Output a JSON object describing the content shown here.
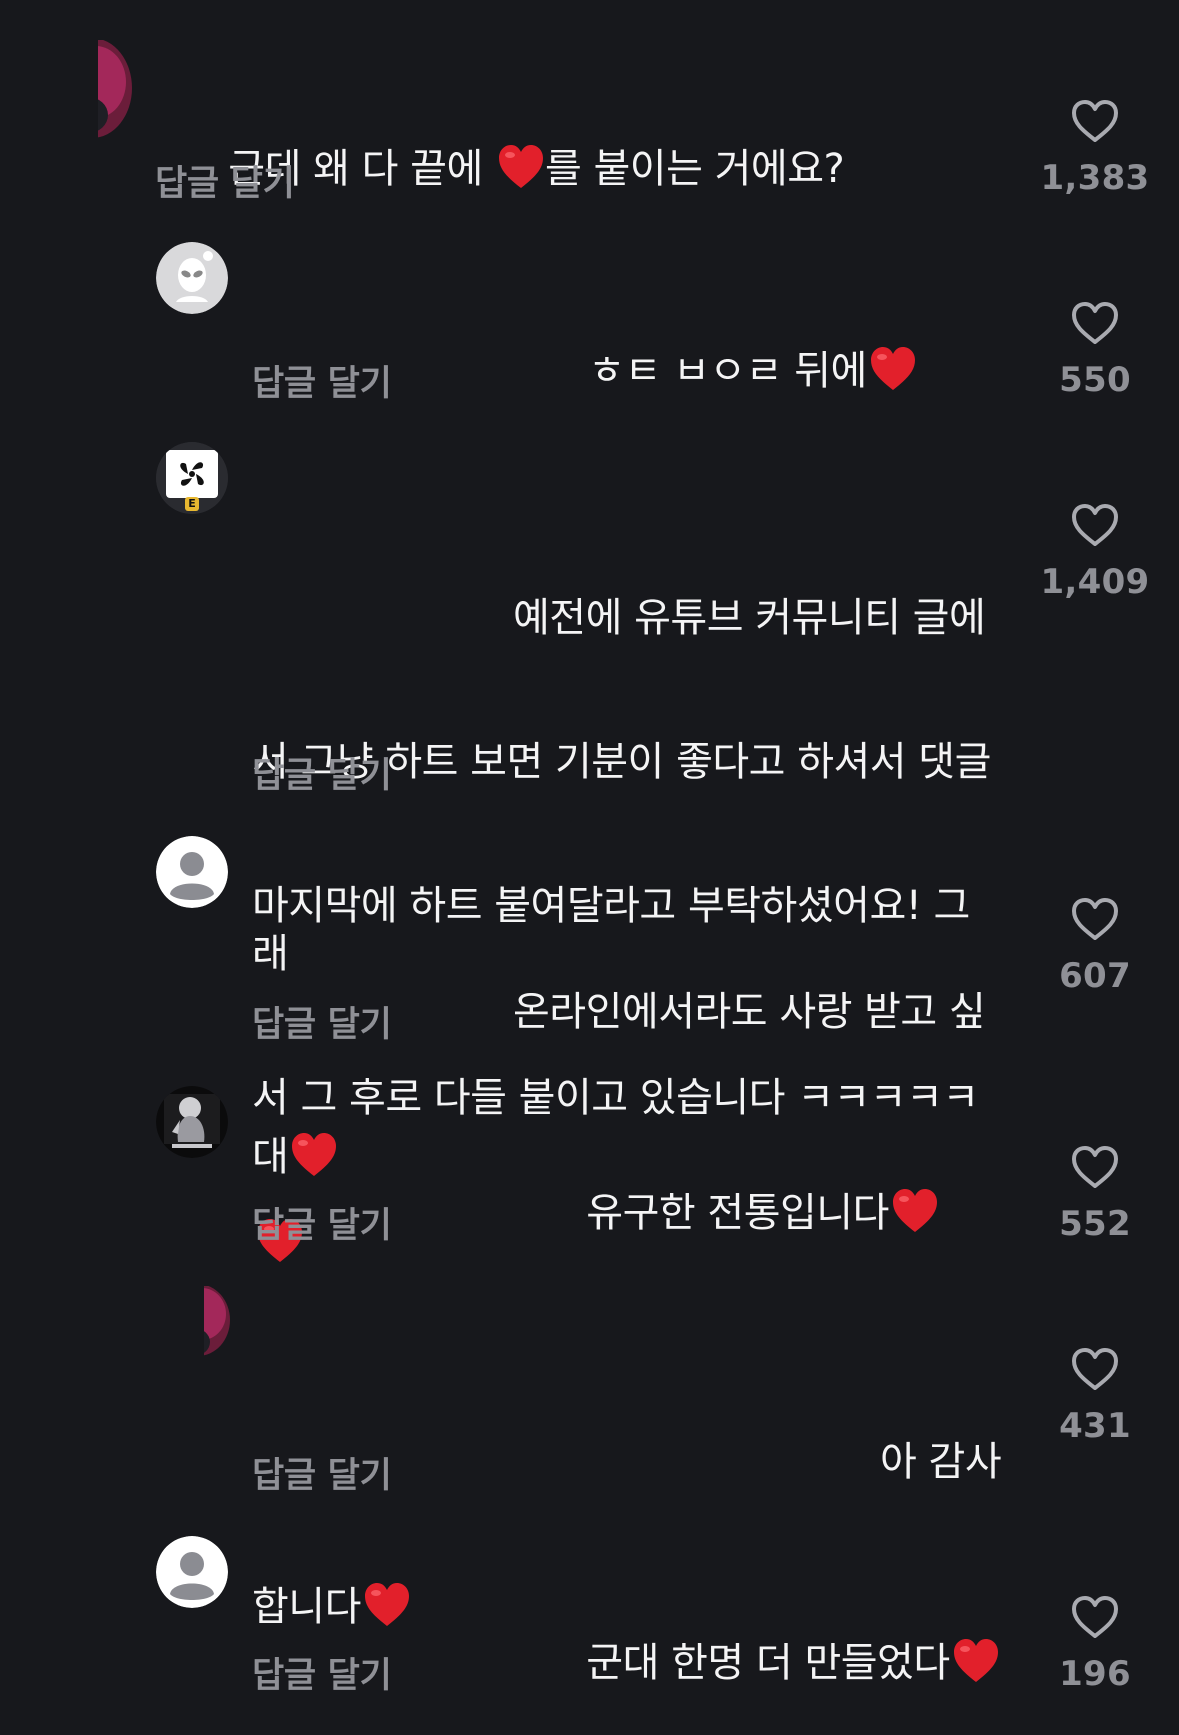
{
  "comments": [
    {
      "text_before": "근데 왜 다 끝에 ",
      "text_after": "를 붙이는 거에요?",
      "reply_label": "답글 달기",
      "like_count": "1,383",
      "avatar": "pink-partial-avatar"
    },
    {
      "text_before": "ㅎㅌ ㅂㅇㄹ 뒤에",
      "text_after": "",
      "reply_label": "답글 달기",
      "like_count": "550",
      "avatar": "alien-avatar"
    },
    {
      "line1": "예전에 유튜브 커뮤니티 글에",
      "line2": "서 그냥 하트 보면 기분이 좋다고 하셔서 댓글",
      "line3": "마지막에 하트 붙여달라고 부탁하셨어요! 그래",
      "line4": "서 그 후로 다들 붙이고 있습니다 ㅋㅋㅋㅋㅋ",
      "reply_label": "답글 달기",
      "like_count": "1,409",
      "avatar": "pinwheel-avatar",
      "badge": "E"
    },
    {
      "line1": "온라인에서라도 사랑 받고 싶",
      "line2": "대",
      "reply_label": "답글 달기",
      "like_count": "607",
      "avatar": "default-person-avatar"
    },
    {
      "text_before": "유구한 전통입니다",
      "reply_label": "답글 달기",
      "like_count": "552",
      "avatar": "sculpture-avatar"
    },
    {
      "line1": "아 감사",
      "line2": "합니다",
      "reply_label": "답글 달기",
      "like_count": "431",
      "avatar": "pink-partial-avatar"
    },
    {
      "text_before": "군대 한명 더 만들었다",
      "reply_label": "답글 달기",
      "like_count": "196",
      "avatar": "default-person-avatar"
    }
  ],
  "colors": {
    "background": "#17181c",
    "text": "#f4f4f5",
    "secondary": "#8f9096",
    "heart": "#e2202b"
  }
}
